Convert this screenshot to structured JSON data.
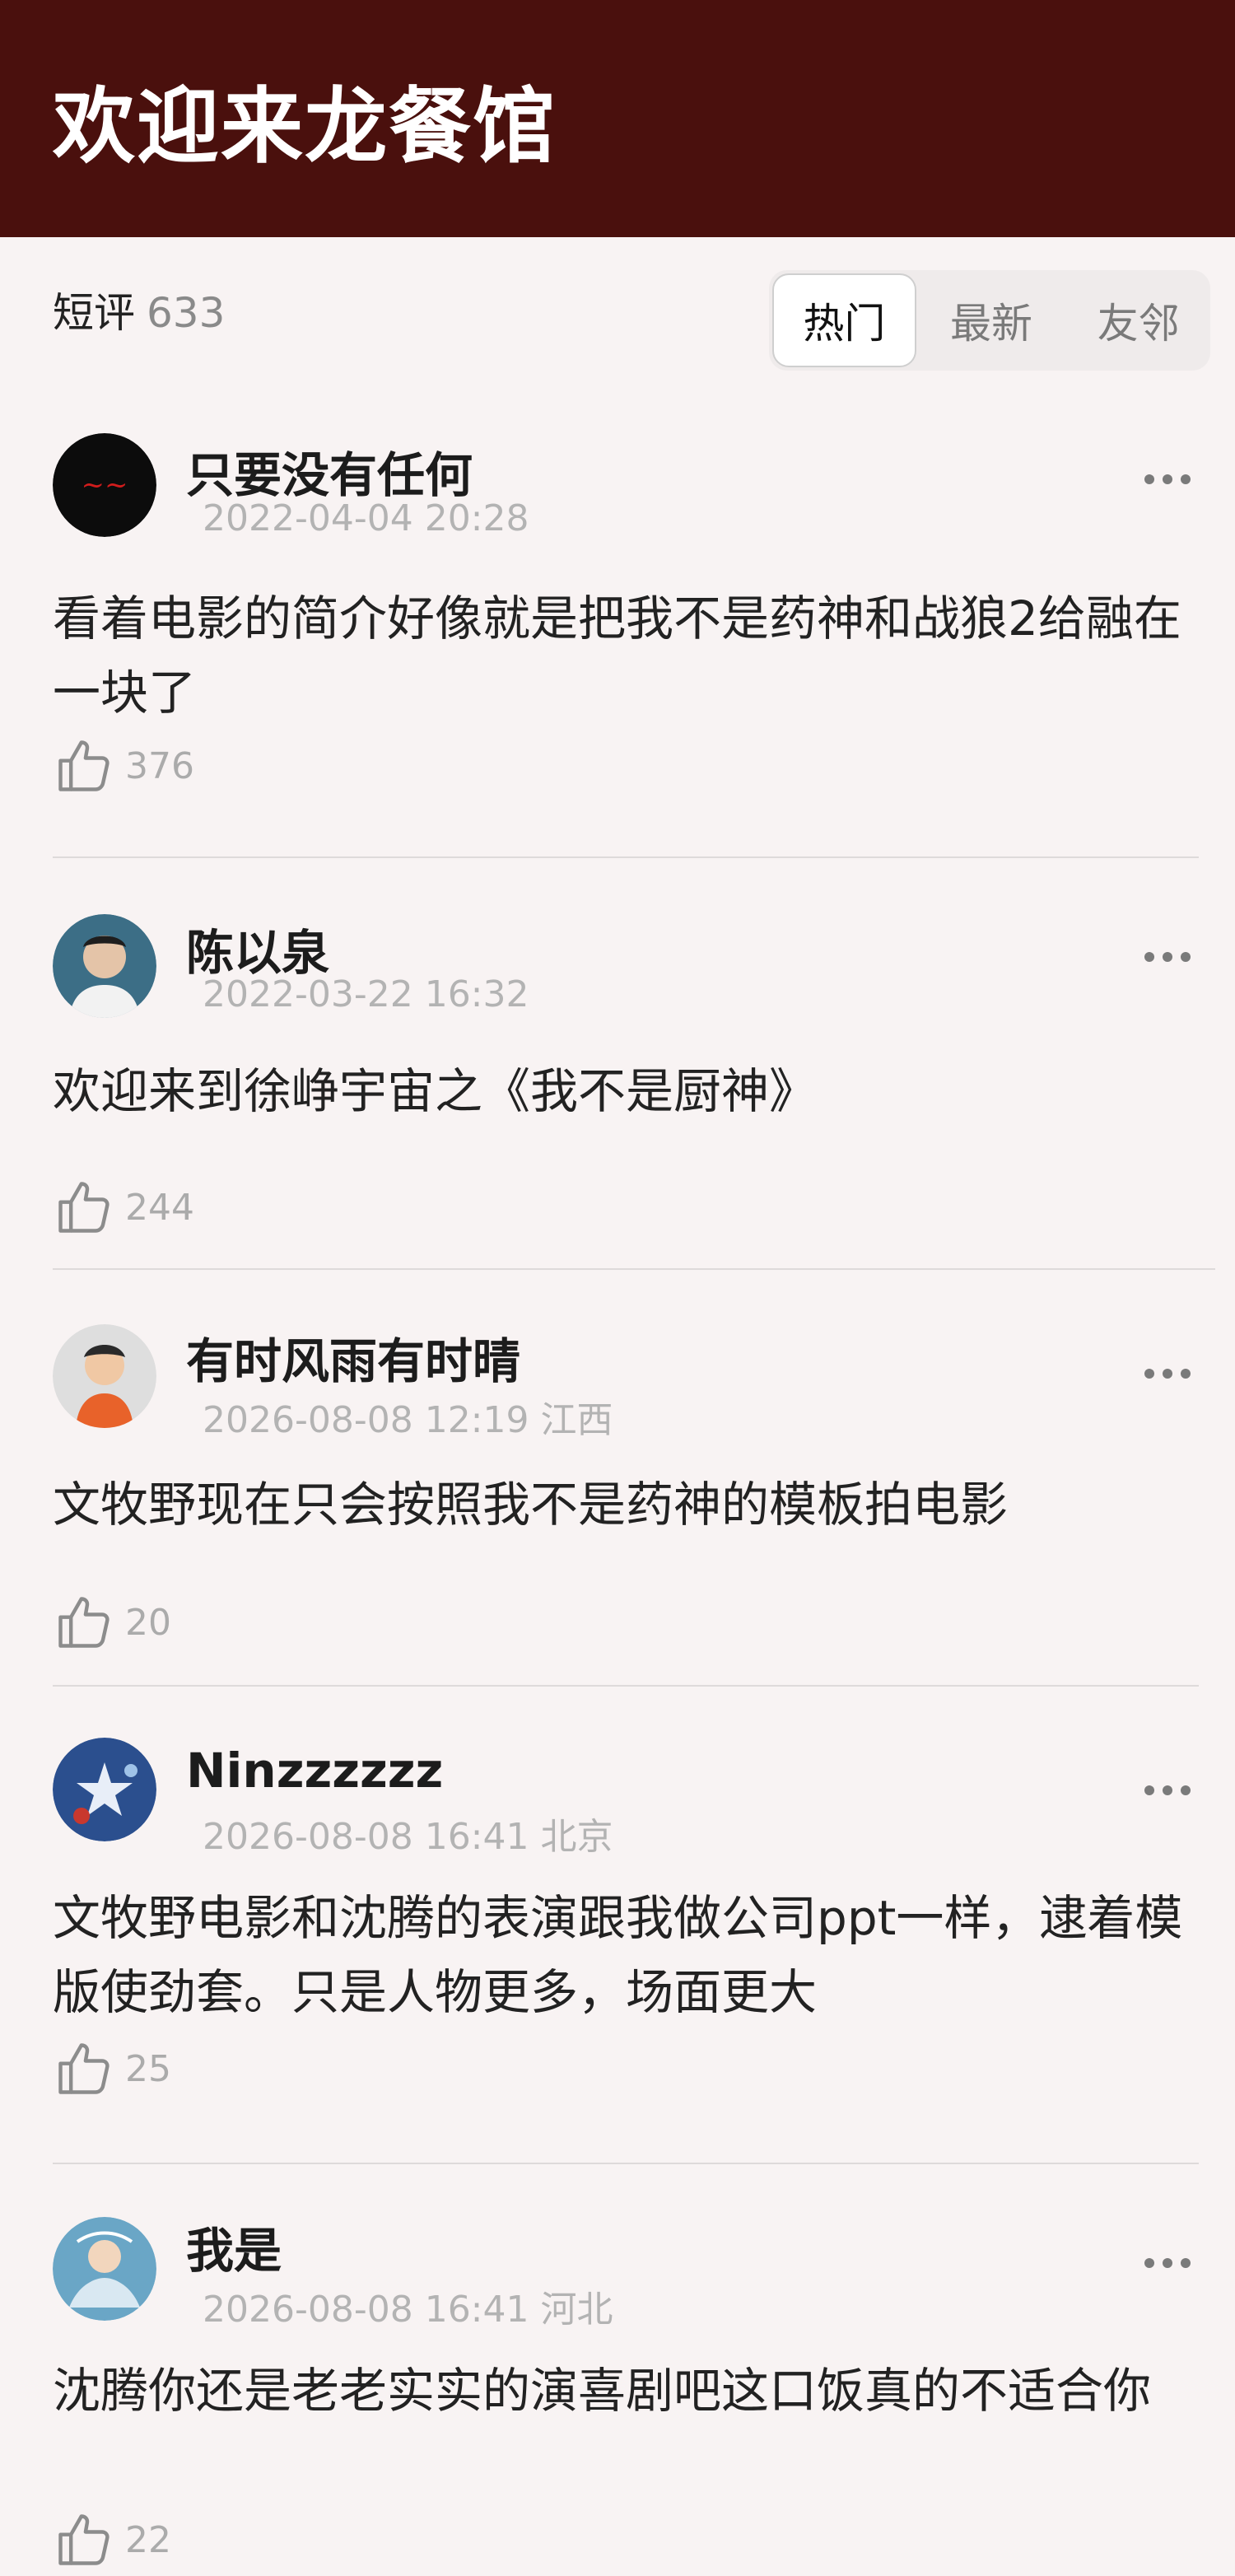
{
  "header": {
    "title": "欢迎来龙餐馆"
  },
  "summary": {
    "label": "短评",
    "count": "633"
  },
  "tabs": [
    {
      "label": "热门",
      "active": true
    },
    {
      "label": "最新",
      "active": false
    },
    {
      "label": "友邻",
      "active": false
    }
  ],
  "comments": [
    {
      "user": "只要没有任何",
      "meta": "2022-04-04 20:28",
      "text": "看着电影的简介好像就是把我不是药神和战狼2给融在一块了",
      "likes": "376"
    },
    {
      "user": "陈以泉",
      "meta": "2022-03-22 16:32",
      "text": "欢迎来到徐峥宇宙之《我不是厨神》",
      "likes": "244"
    },
    {
      "user": "有时风雨有时晴",
      "meta": "2026-08-08 12:19 江西",
      "text": "文牧野现在只会按照我不是药神的模板拍电影",
      "likes": "20"
    },
    {
      "user": "Ninzzzzzz",
      "meta": "2026-08-08 16:41 北京",
      "text": "文牧野电影和沈腾的表演跟我做公司ppt一样，逮着模版使劲套。只是人物更多，场面更大",
      "likes": "25"
    },
    {
      "user": "我是",
      "meta": "2026-08-08 16:41 河北",
      "text": "沈腾你还是老老实实的演喜剧吧这口饭真的不适合你",
      "likes": "22"
    }
  ],
  "icons": {
    "more": "more-dots-icon",
    "like": "thumbs-up-icon"
  },
  "colors": {
    "header_bg": "#4a100d",
    "page_bg": "#f8f3f3"
  }
}
